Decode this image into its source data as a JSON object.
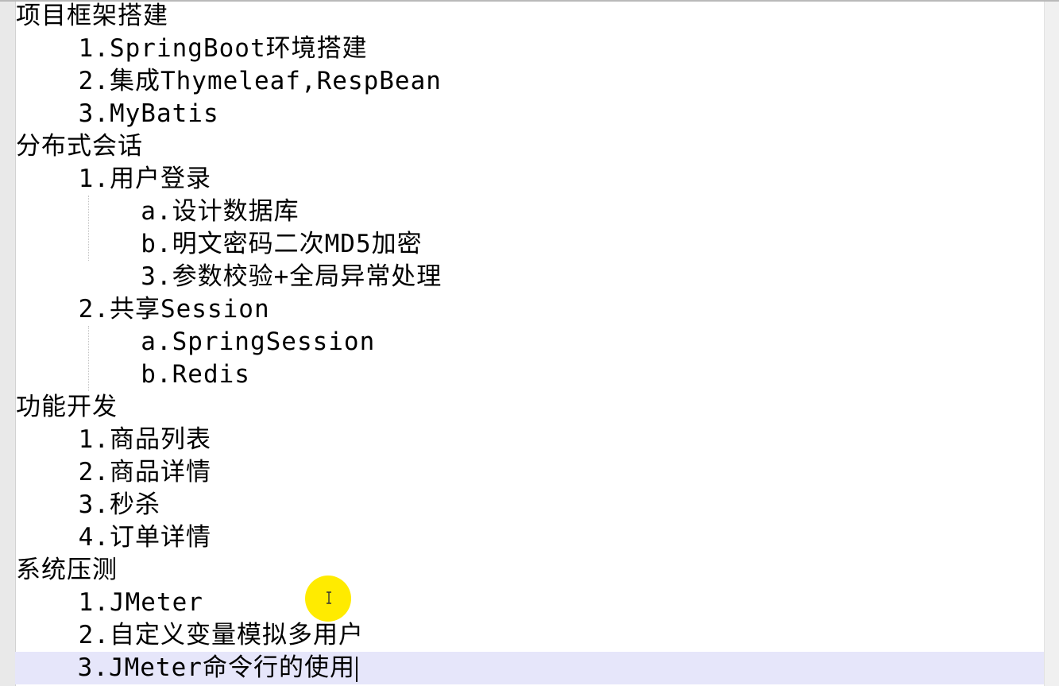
{
  "editor": {
    "lines": [
      "项目框架搭建",
      "    1.SpringBoot环境搭建",
      "    2.集成Thymeleaf,RespBean",
      "    3.MyBatis",
      "分布式会话",
      "    1.用户登录",
      "        a.设计数据库",
      "        b.明文密码二次MD5加密",
      "        3.参数校验+全局异常处理",
      "    2.共享Session",
      "        a.SpringSession",
      "        b.Redis",
      "功能开发",
      "    1.商品列表",
      "    2.商品详情",
      "    3.秒杀",
      "    4.订单详情",
      "系统压测",
      "    1.JMeter",
      "    2.自定义变量模拟多用户",
      "    3.JMeter命令行的使用"
    ],
    "current_line_index": 20,
    "current_line_color": "#e6e6fa",
    "text_color": "#000000",
    "cursor_highlight_color": "#ffeb00",
    "cursor_icon": "text-cursor-icon"
  }
}
